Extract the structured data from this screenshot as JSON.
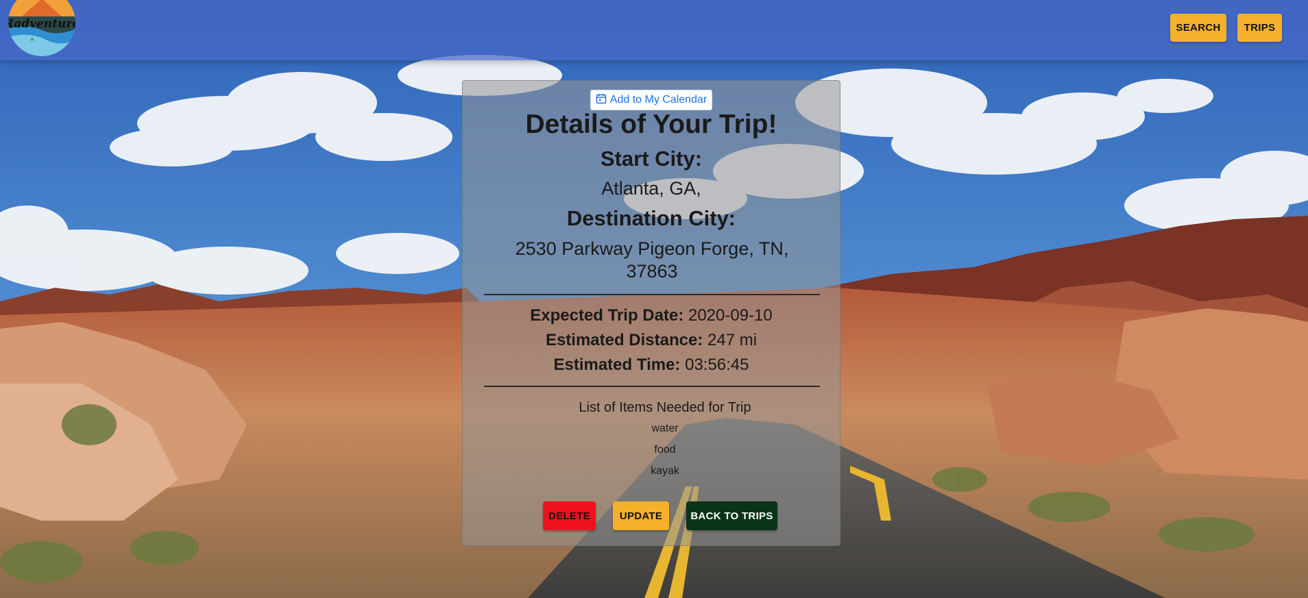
{
  "header": {
    "logo_text": "Radventure",
    "nav": {
      "search_label": "SEARCH",
      "trips_label": "TRIPS"
    }
  },
  "card": {
    "calendar_button_label": "Add to My Calendar",
    "title": "Details of Your Trip!",
    "start_city_label": "Start City:",
    "start_city_value": "Atlanta, GA,",
    "destination_city_label": "Destination City:",
    "destination_city_value": "2530 Parkway Pigeon Forge, TN, 37863",
    "details": [
      {
        "label": "Expected Trip Date:",
        "value": "2020-09-10"
      },
      {
        "label": "Estimated Distance:",
        "value": "247 mi"
      },
      {
        "label": "Estimated Time:",
        "value": "03:56:45"
      }
    ],
    "items_heading": "List of Items Needed for Trip",
    "items": [
      "water",
      "food",
      "kayak"
    ],
    "buttons": {
      "delete_label": "DELETE",
      "update_label": "UPDATE",
      "back_label": "BACK TO TRIPS"
    }
  },
  "colors": {
    "header": "#4866c8",
    "primary_button": "#f5b12a",
    "delete_button": "#f0111f",
    "back_button": "#0a3317",
    "calendar_link": "#1a73e8"
  },
  "icons": {
    "calendar": "calendar-icon"
  }
}
